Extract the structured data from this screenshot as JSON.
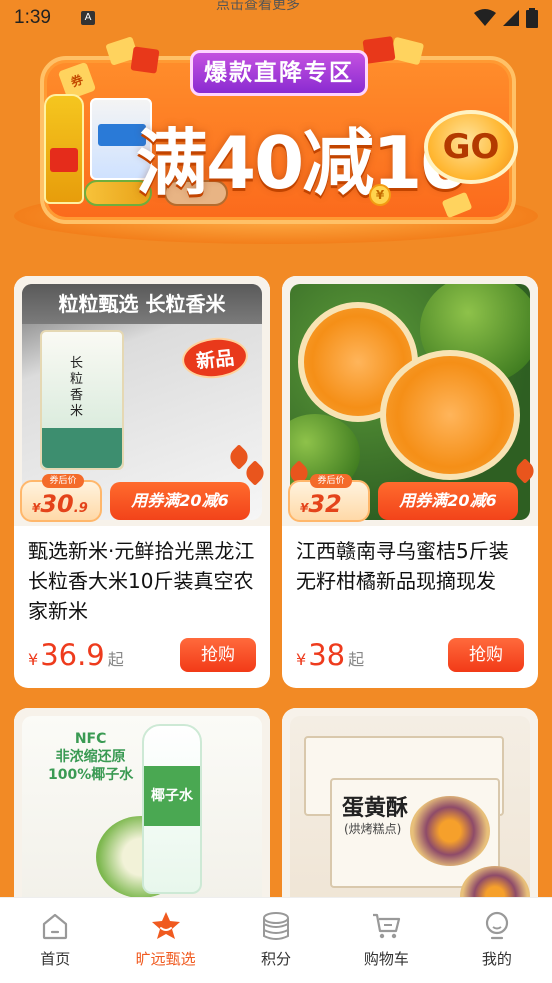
{
  "status_bar": {
    "time": "1:39",
    "app_icon": "A",
    "notch_text": "点击查看更多"
  },
  "banner": {
    "tag": "爆款直降专区",
    "headline": "满40减10",
    "go_label": "GO",
    "coupon_mark": "券",
    "coin_mark": "¥"
  },
  "products": [
    {
      "image_caption": "粒粒甄选 长粒香米",
      "image_badge": "新品",
      "pack_title": "长粒香米",
      "after_coupon_label": "券后价",
      "after_coupon_symbol": "¥",
      "after_coupon_int": "30",
      "after_coupon_dec": ".9",
      "coupon_rule": "用券满20减6",
      "title": "甄选新米·元鲜拾光黑龙江长粒香大米10斤装真空农家新米",
      "price_symbol": "¥",
      "price": "36.9",
      "price_suffix": "起",
      "buy_label": "抢购"
    },
    {
      "after_coupon_label": "券后价",
      "after_coupon_symbol": "¥",
      "after_coupon_int": "32",
      "after_coupon_dec": "",
      "coupon_rule": "用券满20减6",
      "title": "江西赣南寻乌蜜桔5斤装无籽柑橘新品现摘现发",
      "price_symbol": "¥",
      "price": "38",
      "price_suffix": "起",
      "buy_label": "抢购"
    },
    {
      "image_caption": "NFC\n非浓缩还原\n100%椰子水",
      "bottle_label": "椰子水"
    },
    {
      "image_caption": "蛋黄酥",
      "box_sub": "(烘烤糕点)"
    }
  ],
  "tabbar": {
    "items": [
      {
        "label": "首页",
        "icon": "home-icon",
        "active": false
      },
      {
        "label": "旷远甄选",
        "icon": "star-icon",
        "active": true
      },
      {
        "label": "积分",
        "icon": "coins-icon",
        "active": false
      },
      {
        "label": "购物车",
        "icon": "cart-icon",
        "active": false
      },
      {
        "label": "我的",
        "icon": "profile-icon",
        "active": false
      }
    ],
    "active_color": "#f05a1f"
  },
  "colors": {
    "background": "#f28a25",
    "accent": "#ee3b1d",
    "banner_tag": "#8a2bd1"
  }
}
